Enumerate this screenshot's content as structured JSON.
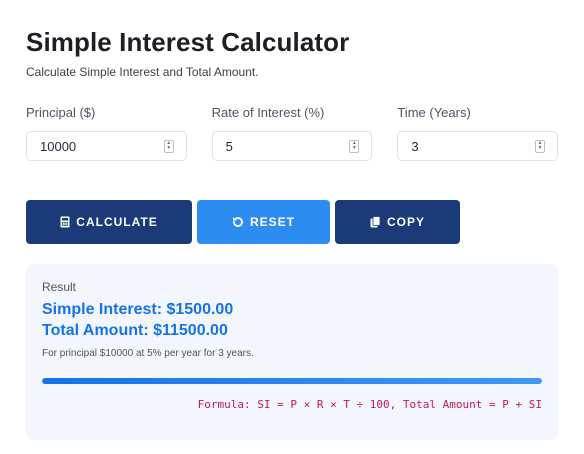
{
  "header": {
    "title": "Simple Interest Calculator",
    "subtitle": "Calculate Simple Interest and Total Amount."
  },
  "fields": {
    "principal": {
      "label": "Principal ($)",
      "value": "10000"
    },
    "rate": {
      "label": "Rate of Interest (%)",
      "value": "5"
    },
    "time": {
      "label": "Time (Years)",
      "value": "3"
    }
  },
  "buttons": {
    "calculate": {
      "label": "CALCULATE",
      "icon": "calculator-icon"
    },
    "reset": {
      "label": "RESET",
      "icon": "undo-icon"
    },
    "copy": {
      "label": "COPY",
      "icon": "copy-icon"
    }
  },
  "result": {
    "label": "Result",
    "simple_interest": "Simple Interest: $1500.00",
    "total_amount": "Total Amount: $11500.00",
    "note": "For principal $10000 at 5% per year for 3 years.",
    "progress": 1.0,
    "formula": "Formula: SI = P × R × T ÷ 100, Total Amount = P + SI"
  },
  "colors": {
    "primary_dark": "#1a3a78",
    "primary_light": "#2d8cf0",
    "result_text": "#1673e6",
    "formula_text": "#c2185b"
  }
}
